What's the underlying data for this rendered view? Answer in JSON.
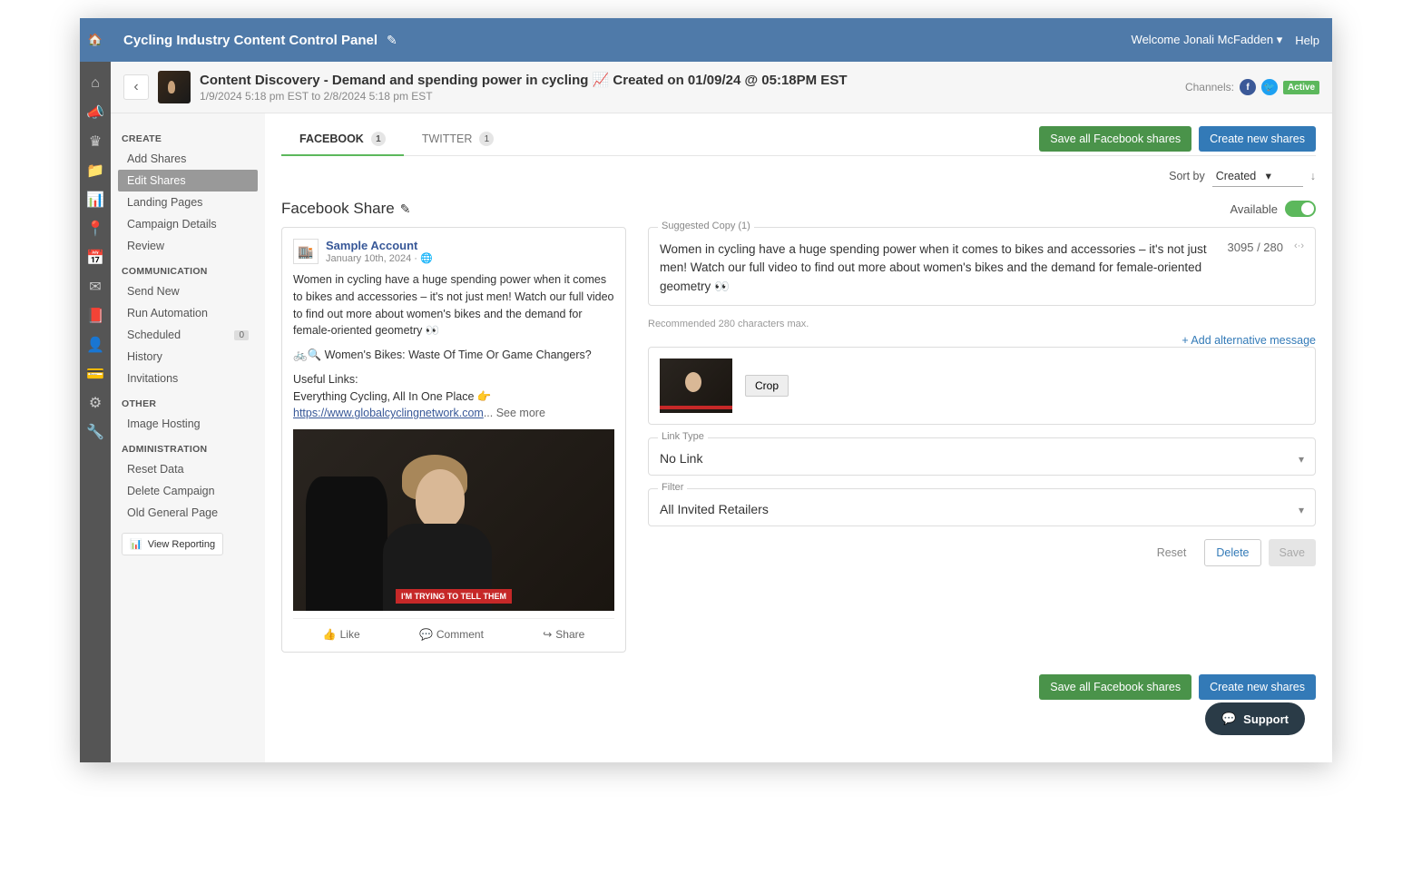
{
  "topbar": {
    "brand": "Cycling Industry Content Control Panel",
    "welcome": "Welcome Jonali McFadden ▾",
    "help": "Help"
  },
  "header": {
    "title": "Content Discovery - Demand and spending power in cycling 📈 Created on 01/09/24 @ 05:18PM EST",
    "subtitle": "1/9/2024 5:18 pm EST to 2/8/2024 5:18 pm EST",
    "channels_label": "Channels:",
    "active_badge": "Active"
  },
  "sidebar": {
    "groups": {
      "create": {
        "title": "CREATE",
        "items": [
          "Add Shares",
          "Edit Shares",
          "Landing Pages",
          "Campaign Details",
          "Review"
        ],
        "active_index": 1
      },
      "communication": {
        "title": "COMMUNICATION",
        "items": [
          "Send New",
          "Run Automation",
          "Scheduled",
          "History",
          "Invitations"
        ],
        "scheduled_badge": "0"
      },
      "other": {
        "title": "OTHER",
        "items": [
          "Image Hosting"
        ]
      },
      "administration": {
        "title": "ADMINISTRATION",
        "items": [
          "Reset Data",
          "Delete Campaign",
          "Old General Page"
        ]
      }
    },
    "view_reporting": "View Reporting"
  },
  "tabs": {
    "facebook": {
      "label": "FACEBOOK",
      "count": "1"
    },
    "twitter": {
      "label": "TWITTER",
      "count": "1"
    },
    "save_all": "Save all Facebook shares",
    "create_new": "Create new shares"
  },
  "sort": {
    "label": "Sort by",
    "value": "Created"
  },
  "share": {
    "heading": "Facebook Share",
    "available_label": "Available",
    "preview": {
      "account_name": "Sample Account",
      "account_meta": "January 10th, 2024 · 🌐",
      "body1": "Women in cycling have a huge spending power when it comes to bikes and accessories – it's not just men! Watch our full video to find out more about women's bikes and the demand for female-oriented geometry 👀",
      "body2": "🚲🔍 Women's Bikes: Waste Of Time Or Game Changers?",
      "useful_links_label": "Useful Links:",
      "links_line": "Everything Cycling, All In One Place 👉",
      "link_url": "https://www.globalcyclingnetwork.com",
      "see_more": "... See more",
      "video_caption": "I'M TRYING TO TELL THEM",
      "actions": {
        "like": "Like",
        "comment": "Comment",
        "share": "Share"
      }
    },
    "editor": {
      "suggested_copy_legend": "Suggested Copy (1)",
      "copy_text": "Women in cycling have a huge spending power when it comes to bikes and accessories – it's not just men! Watch our full video to find out more about women's bikes and the demand for female-oriented geometry 👀",
      "char_count": "3095 / 280",
      "recommended_note": "Recommended 280 characters max.",
      "add_alternative": "+ Add alternative message",
      "crop_button": "Crop",
      "link_type_legend": "Link Type",
      "link_type_value": "No Link",
      "filter_legend": "Filter",
      "filter_value": "All Invited Retailers",
      "reset": "Reset",
      "delete": "Delete",
      "save": "Save"
    },
    "bottom": {
      "save_all": "Save all Facebook shares",
      "create_new": "Create new shares"
    }
  },
  "support": {
    "label": "Support"
  }
}
